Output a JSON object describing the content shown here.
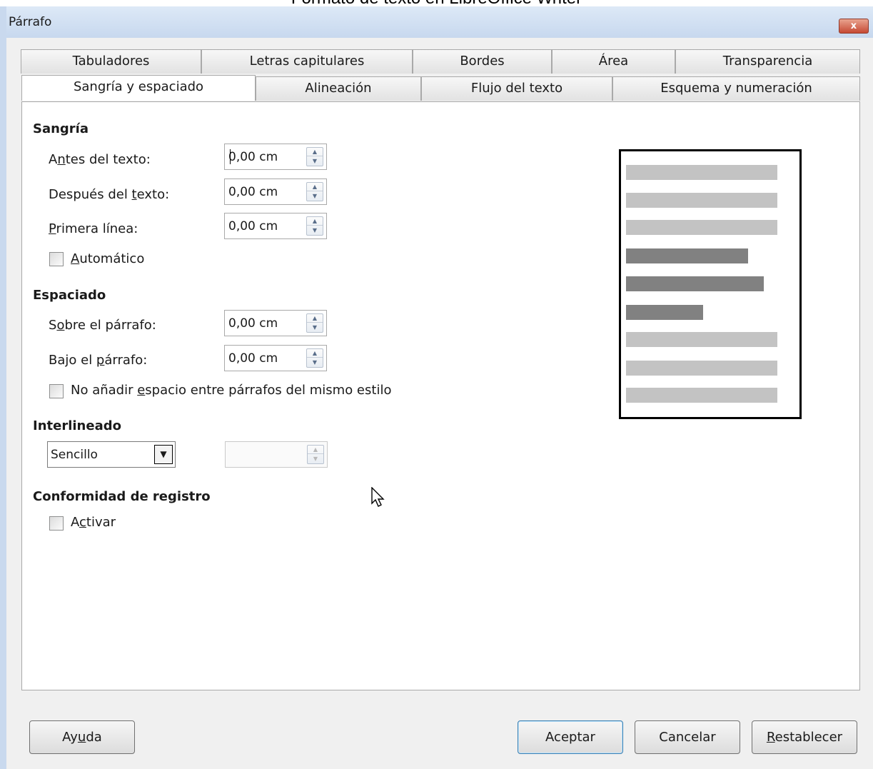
{
  "caption": "Formato de texto en LibreOffice Writer",
  "window": {
    "title": "Párrafo",
    "close_glyph": "x"
  },
  "tabs": {
    "row_back": [
      "Tabuladores",
      "Letras capitulares",
      "Bordes",
      "Área",
      "Transparencia"
    ],
    "row_front": [
      "Sangría y espaciado",
      "Alineación",
      "Flujo del texto",
      "Esquema y numeración"
    ],
    "active": "Sangría y espaciado"
  },
  "indent": {
    "title": "Sangría",
    "before": {
      "pre": "A",
      "ul": "n",
      "post": "tes del texto:",
      "value": "0,00 cm"
    },
    "after": {
      "pre": "Después del ",
      "ul": "t",
      "post": "exto:",
      "value": "0,00 cm"
    },
    "first_line": {
      "pre": "",
      "ul": "P",
      "post": "rimera línea:",
      "value": "0,00 cm"
    },
    "automatic": {
      "pre": "",
      "ul": "A",
      "post": "utomático",
      "checked": false
    }
  },
  "spacing": {
    "title": "Espaciado",
    "above": {
      "pre": "S",
      "ul": "o",
      "post": "bre el párrafo:",
      "value": "0,00 cm"
    },
    "below": {
      "pre": "Bajo el ",
      "ul": "p",
      "post": "árrafo:",
      "value": "0,00 cm"
    },
    "no_space": {
      "pre": "No añadir ",
      "ul": "e",
      "post": "spacio entre párrafos del mismo estilo",
      "checked": false
    }
  },
  "line_spacing": {
    "title": "Interlineado",
    "selected": "Sencillo",
    "value": "",
    "value_enabled": false
  },
  "register": {
    "title": "Conformidad de registro",
    "activate": {
      "pre": "A",
      "ul": "c",
      "post": "tivar",
      "checked": false
    }
  },
  "preview": {
    "lines": [
      "light",
      "light",
      "light",
      "dark",
      "dark",
      "dark",
      "light",
      "light",
      "light"
    ]
  },
  "buttons": {
    "help": {
      "pre": "Ay",
      "ul": "u",
      "post": "da"
    },
    "ok": "Aceptar",
    "cancel": "Cancelar",
    "reset": {
      "pre": "",
      "ul": "R",
      "post": "establecer"
    }
  }
}
